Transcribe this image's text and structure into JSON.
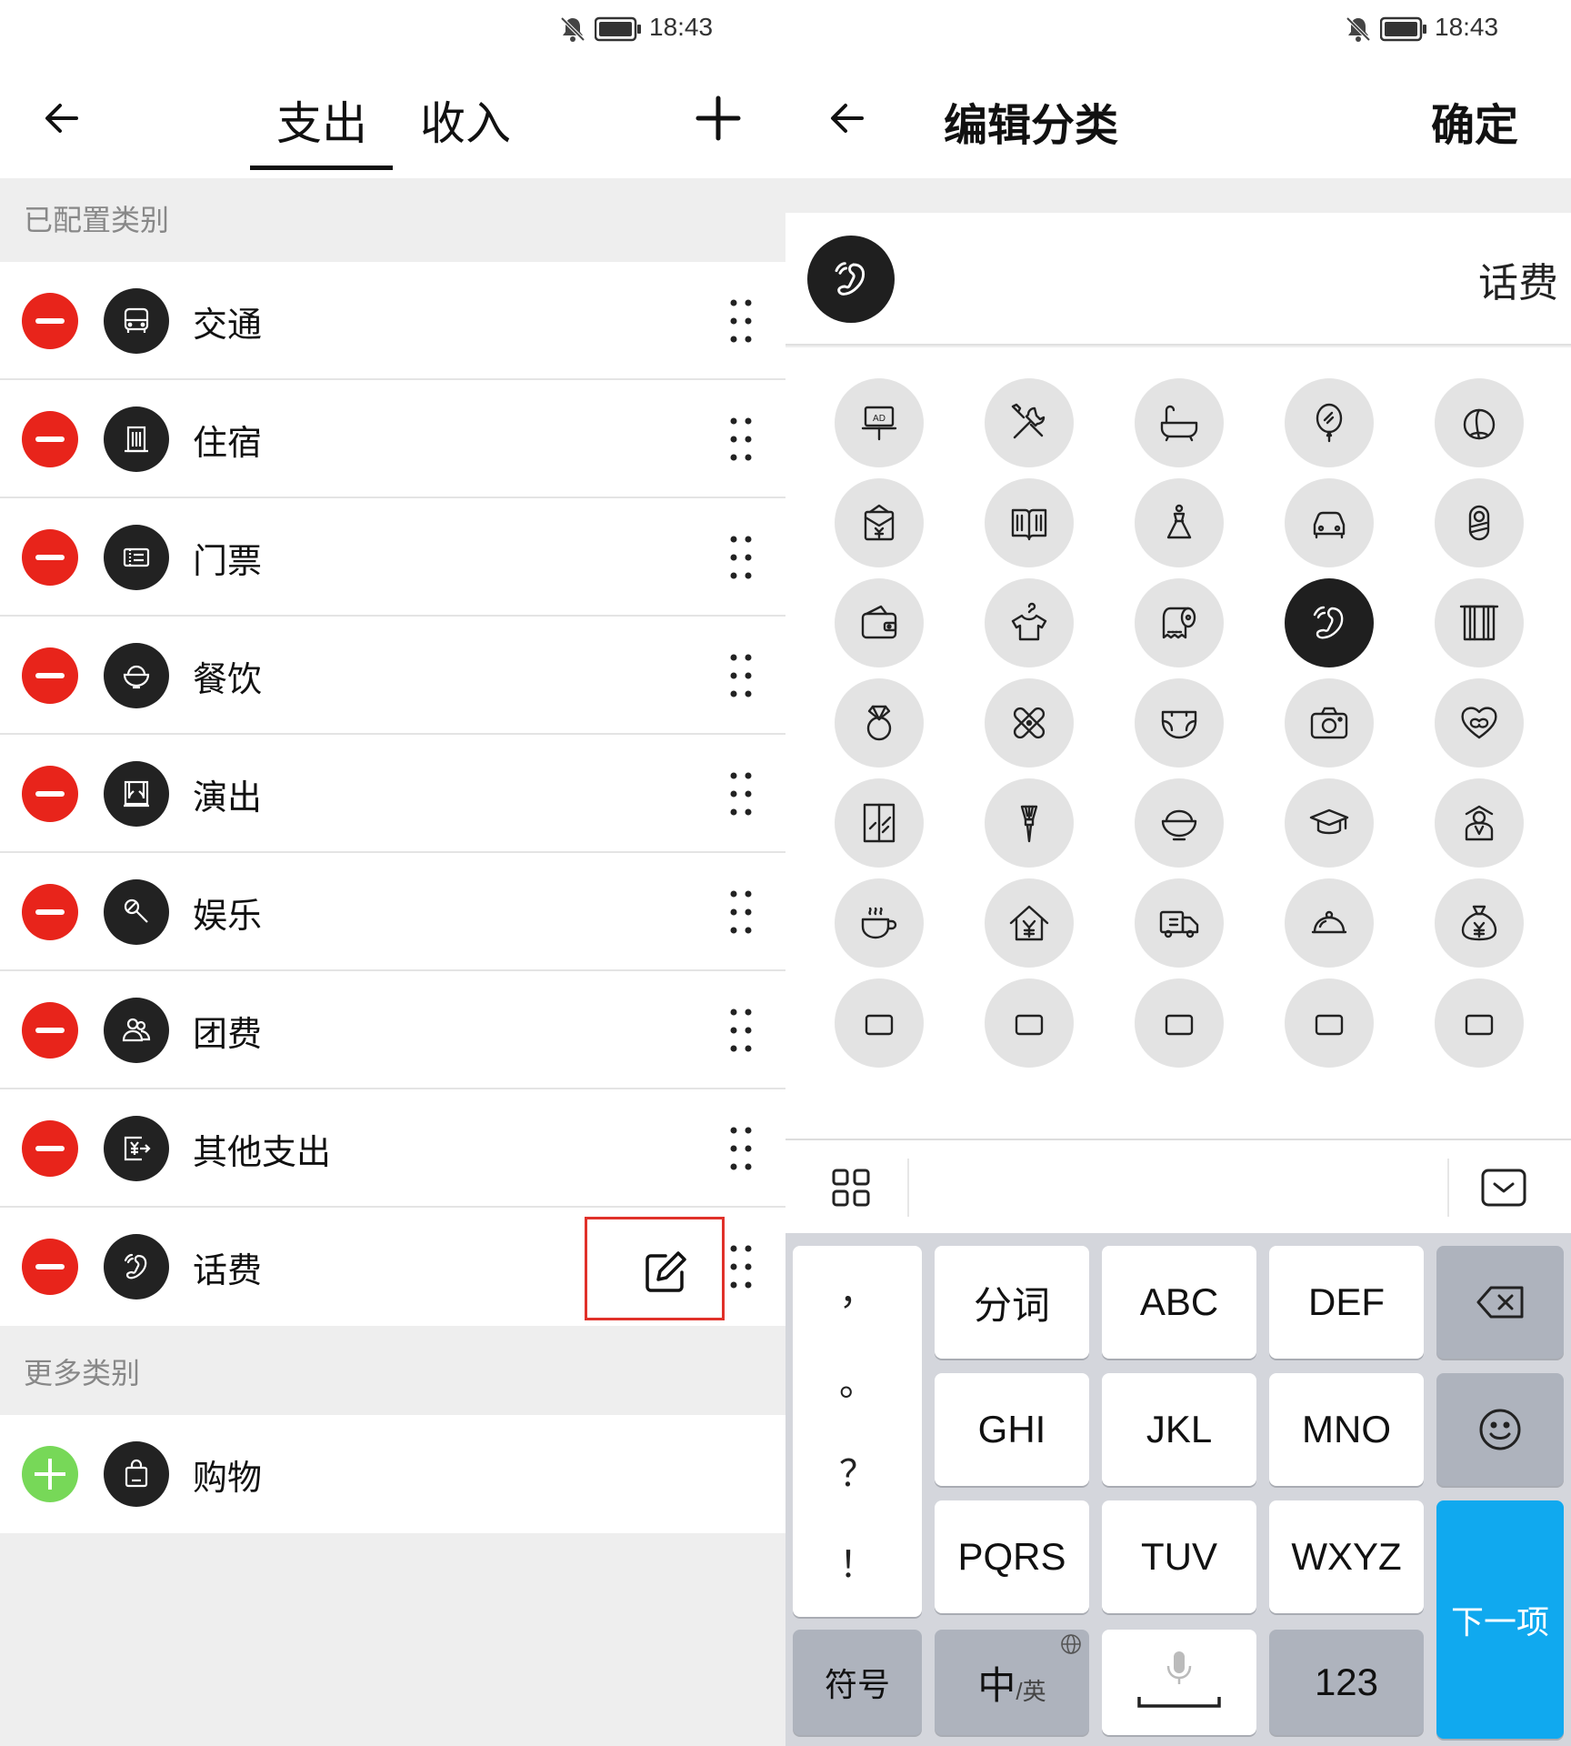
{
  "status": {
    "time": "18:43"
  },
  "left": {
    "tabs": [
      {
        "label": "支出"
      },
      {
        "label": "收入"
      }
    ],
    "configured_section": "已配置类别",
    "configured": [
      {
        "label": "交通",
        "icon": "bus-icon"
      },
      {
        "label": "住宿",
        "icon": "building-icon"
      },
      {
        "label": "门票",
        "icon": "ticket-icon"
      },
      {
        "label": "餐饮",
        "icon": "rice-bowl-icon"
      },
      {
        "label": "演出",
        "icon": "stage-icon"
      },
      {
        "label": "娱乐",
        "icon": "microphone-icon"
      },
      {
        "label": "团费",
        "icon": "group-icon"
      },
      {
        "label": "其他支出",
        "icon": "yen-export-icon"
      },
      {
        "label": "话费",
        "icon": "phone-icon"
      }
    ],
    "more_section": "更多类别",
    "more": [
      {
        "label": "购物",
        "icon": "shopping-bag-icon"
      }
    ]
  },
  "right": {
    "title": "编辑分类",
    "confirm": "确定",
    "selected_icon": "phone-icon",
    "name_value": "话费",
    "icon_grid": [
      "ad-board-icon",
      "tools-icon",
      "bathtub-icon",
      "balloon-icon",
      "peach-icon",
      "red-envelope-icon",
      "book-icon",
      "dress-icon",
      "car-icon",
      "baby-icon",
      "wallet-icon",
      "shirt-hanger-icon",
      "paper-roll-icon",
      "phone-icon",
      "curtain-icon",
      "ring-icon",
      "bandage-icon",
      "diaper-icon",
      "camera-icon",
      "heart-icon",
      "window-icon",
      "brush-icon",
      "bowl-icon",
      "graduation-cap-icon",
      "elder-icon",
      "coffee-cup-icon",
      "house-yen-icon",
      "truck-icon",
      "food-cloche-icon",
      "money-bag-icon"
    ],
    "active_icon_index": 13,
    "keyboard": {
      "punct": [
        "，",
        "。",
        "？",
        "！"
      ],
      "row1": [
        "分词",
        "ABC",
        "DEF"
      ],
      "row2": [
        "GHI",
        "JKL",
        "MNO"
      ],
      "row3": [
        "PQRS",
        "TUV",
        "WXYZ"
      ],
      "symbols": "符号",
      "lang_main": "中",
      "lang_sub": "/英",
      "num": "123",
      "next": "下一项"
    }
  }
}
